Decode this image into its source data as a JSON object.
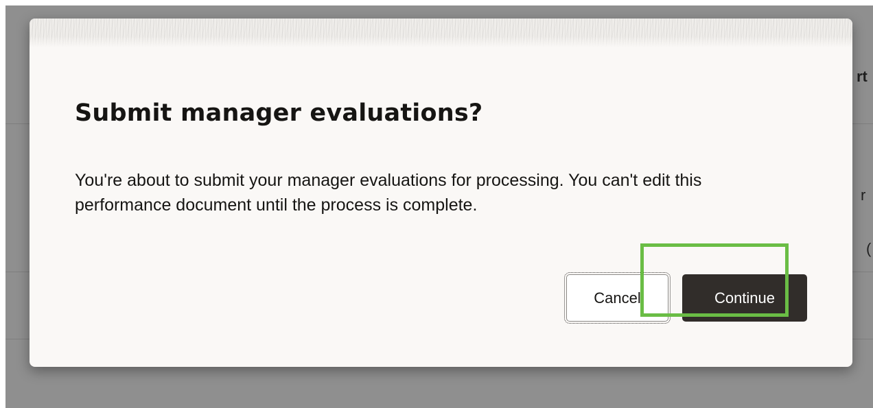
{
  "background": {
    "fragments": [
      "rt",
      "r",
      "("
    ]
  },
  "dialog": {
    "title": "Submit manager evaluations?",
    "message": "You're about to submit your manager evaluations for processing. You can't edit this performance document until the process is complete.",
    "buttons": {
      "cancel_label": "Cancel",
      "continue_label": "Continue"
    }
  },
  "colors": {
    "overlay": "#8f8f8f",
    "dialog_background": "#faf8f6",
    "primary_button": "#312d2a",
    "highlight": "#6abd45"
  }
}
